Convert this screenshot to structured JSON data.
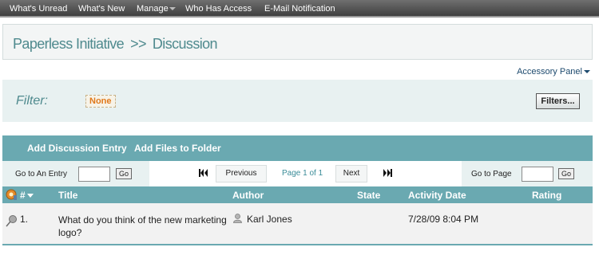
{
  "nav": {
    "items": [
      "What's Unread",
      "What's New",
      "Manage",
      "Who Has Access",
      "E-Mail Notification"
    ]
  },
  "breadcrumb": {
    "parent": "Paperless Initiative",
    "separator": ">>",
    "current": "Discussion"
  },
  "accessory_panel": "Accessory Panel",
  "filter": {
    "label": "Filter:",
    "value": "None",
    "button": "Filters..."
  },
  "actions": {
    "add_entry": "Add Discussion Entry",
    "add_files": "Add Files to Folder"
  },
  "pager": {
    "go_to_entry": "Go to An Entry",
    "go": "Go",
    "previous": "Previous",
    "page_info": "Page 1 of 1",
    "next": "Next",
    "go_to_page": "Go to Page"
  },
  "table": {
    "columns": {
      "number": "#",
      "title": "Title",
      "author": "Author",
      "state": "State",
      "activity_date": "Activity Date",
      "rating": "Rating"
    },
    "rows": [
      {
        "number": "1.",
        "title": "What do you think of the new marketing logo?",
        "author": "Karl Jones",
        "state": "",
        "activity_date": "7/28/09 8:04 PM",
        "rating": ""
      }
    ]
  },
  "colors": {
    "nav_bar": "#4f4f4f",
    "accent_teal": "#6aa9b1",
    "heading_teal": "#4f8a8e",
    "filter_value": "#e0791b"
  }
}
